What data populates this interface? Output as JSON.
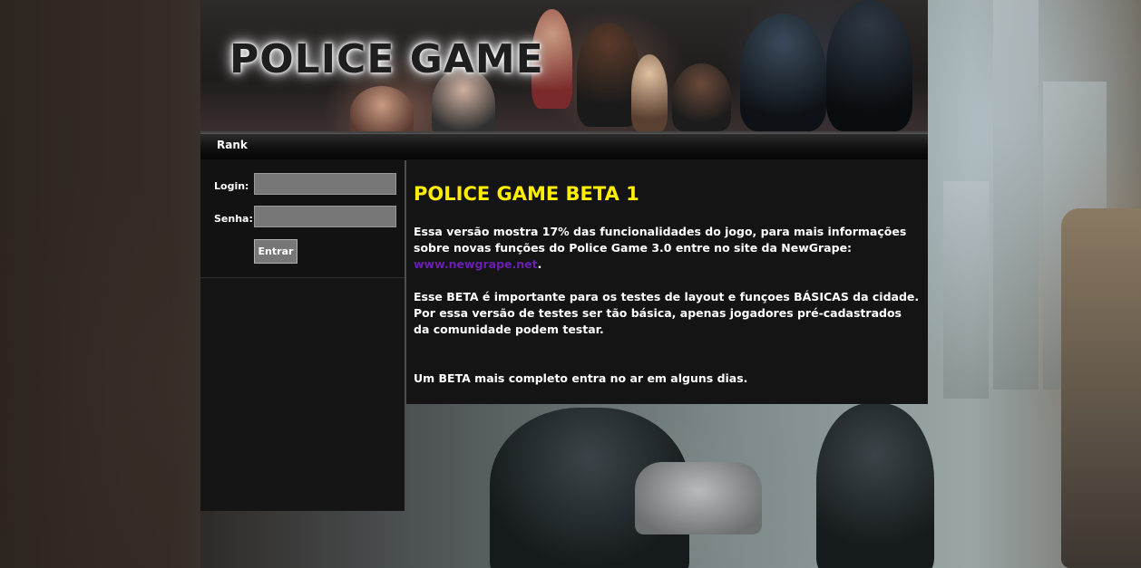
{
  "header": {
    "logo_text": "POLICE GAME"
  },
  "nav": {
    "items": [
      {
        "label": "Rank"
      }
    ]
  },
  "login": {
    "login_label": "Login:",
    "login_value": "",
    "password_label": "Senha:",
    "password_value": "",
    "submit_label": "Entrar"
  },
  "main": {
    "title": "POLICE GAME BETA 1",
    "paragraph1_text": "Essa versão mostra 17% das funcionalidades do jogo, para mais informações sobre novas funções do Police Game 3.0 entre no site da NewGrape: ",
    "paragraph1_link": "www.newgrape.net",
    "paragraph1_end": ".",
    "paragraph2": "Esse BETA é importante para os testes de layout e funçoes BÁSICAS da cidade. Por essa versão de testes ser tão básica, apenas jogadores pré-cadastrados da comunidade podem testar.",
    "paragraph3": "Um BETA mais completo entra no ar em alguns dias."
  },
  "colors": {
    "title": "#ffee00",
    "link": "#6a1fb0",
    "panel_bg": "#141414",
    "input_bg": "#777777"
  }
}
